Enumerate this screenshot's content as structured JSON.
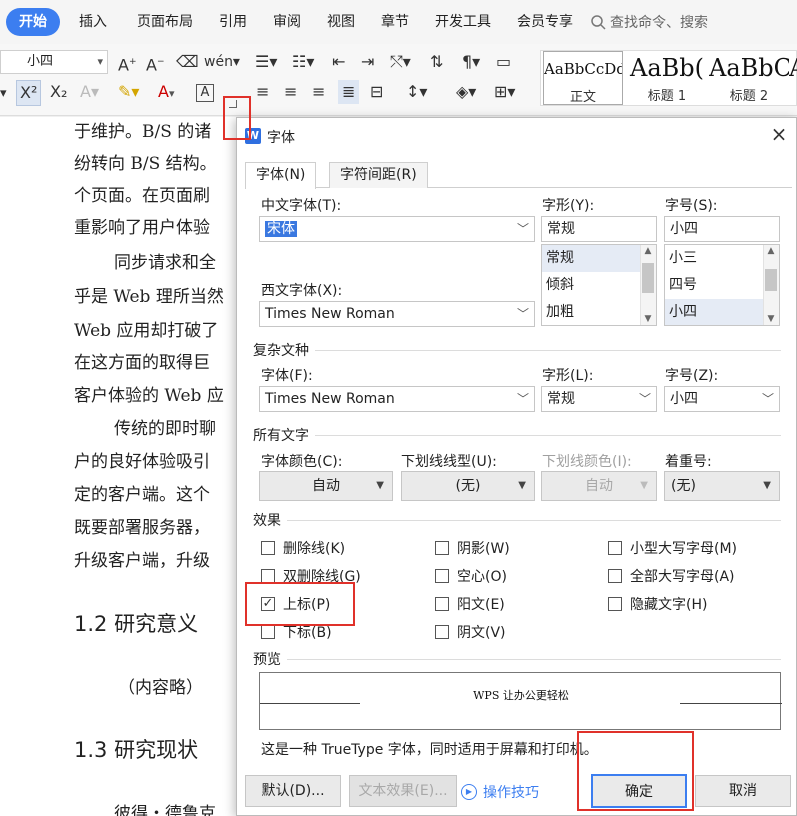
{
  "tabs": [
    "开始",
    "插入",
    "页面布局",
    "引用",
    "审阅",
    "视图",
    "章节",
    "开发工具",
    "会员专享"
  ],
  "search": {
    "placeholder": "查找命令、搜索"
  },
  "ribbon": {
    "font_size_value": "小四",
    "styles": [
      {
        "sample": "AaBbCcDd",
        "label": "正文"
      },
      {
        "sample": "AaBb(",
        "label": "标题 1"
      },
      {
        "sample": "AaBbC",
        "label": "标题 2"
      },
      {
        "sample": "A",
        "label": ""
      }
    ]
  },
  "document": {
    "lines": [
      "于维护。B/S 的诸",
      "纷转向 B/S 结构。",
      "个页面。在页面刷",
      "重影响了用户体验",
      "同步请求和全",
      "乎是 Web 理所当然",
      "Web 应用却打破了",
      "在这方面的取得巨",
      "客户体验的 Web 应",
      "传统的即时聊",
      "户的良好体验吸引",
      "定的客户端。这个",
      "既要部署服务器，",
      "升级客户端，升级"
    ],
    "heading_1": "1.2  研究意义",
    "placeholder": "（内容略）",
    "heading_2": "1.3  研究现状",
    "last_line": "彼得・德鲁克"
  },
  "dialog": {
    "title": "字体",
    "close": "×",
    "tabs": [
      "字体(N)",
      "字符间距(R)"
    ],
    "cn_font_label": "中文字体(T):",
    "cn_font_value": "宋体",
    "style_label": "字形(Y):",
    "style_value": "常规",
    "style_options": [
      "常规",
      "倾斜",
      "加粗"
    ],
    "size_label": "字号(S):",
    "size_value": "小四",
    "size_options": [
      "小三",
      "四号",
      "小四"
    ],
    "latin_font_label": "西文字体(X):",
    "latin_font_value": "Times New Roman",
    "complex_group": "复杂文种",
    "complex_font_label": "字体(F):",
    "complex_font_value": "Times New Roman",
    "complex_style_label": "字形(L):",
    "complex_style_value": "常规",
    "complex_size_label": "字号(Z):",
    "complex_size_value": "小四",
    "all_text_group": "所有文字",
    "font_color_label": "字体颜色(C):",
    "font_color_value": "自动",
    "underline_label": "下划线线型(U):",
    "underline_value": "(无)",
    "underline_color_label": "下划线颜色(I):",
    "underline_color_value": "自动",
    "emphasis_label": "着重号:",
    "emphasis_value": "(无)",
    "effects_group": "效果",
    "effects": [
      {
        "label": "删除线(K)",
        "checked": false
      },
      {
        "label": "阴影(W)",
        "checked": false
      },
      {
        "label": "小型大写字母(M)",
        "checked": false
      },
      {
        "label": "双删除线(G)",
        "checked": false
      },
      {
        "label": "空心(O)",
        "checked": false
      },
      {
        "label": "全部大写字母(A)",
        "checked": false
      },
      {
        "label": "上标(P)",
        "checked": true
      },
      {
        "label": "阳文(E)",
        "checked": false
      },
      {
        "label": "隐藏文字(H)",
        "checked": false
      },
      {
        "label": "下标(B)",
        "checked": false
      },
      {
        "label": "阴文(V)",
        "checked": false
      }
    ],
    "preview_group": "预览",
    "preview_text": "WPS 让办公更轻松",
    "info_text": "这是一种 TrueType 字体，同时适用于屏幕和打印机。",
    "btn_default": "默认(D)...",
    "btn_text_effects": "文本效果(E)...",
    "tips_link": "操作技巧",
    "btn_ok": "确定",
    "btn_cancel": "取消"
  },
  "colors": {
    "accent": "#3c7ef0",
    "highlight_box": "#e0312a"
  }
}
